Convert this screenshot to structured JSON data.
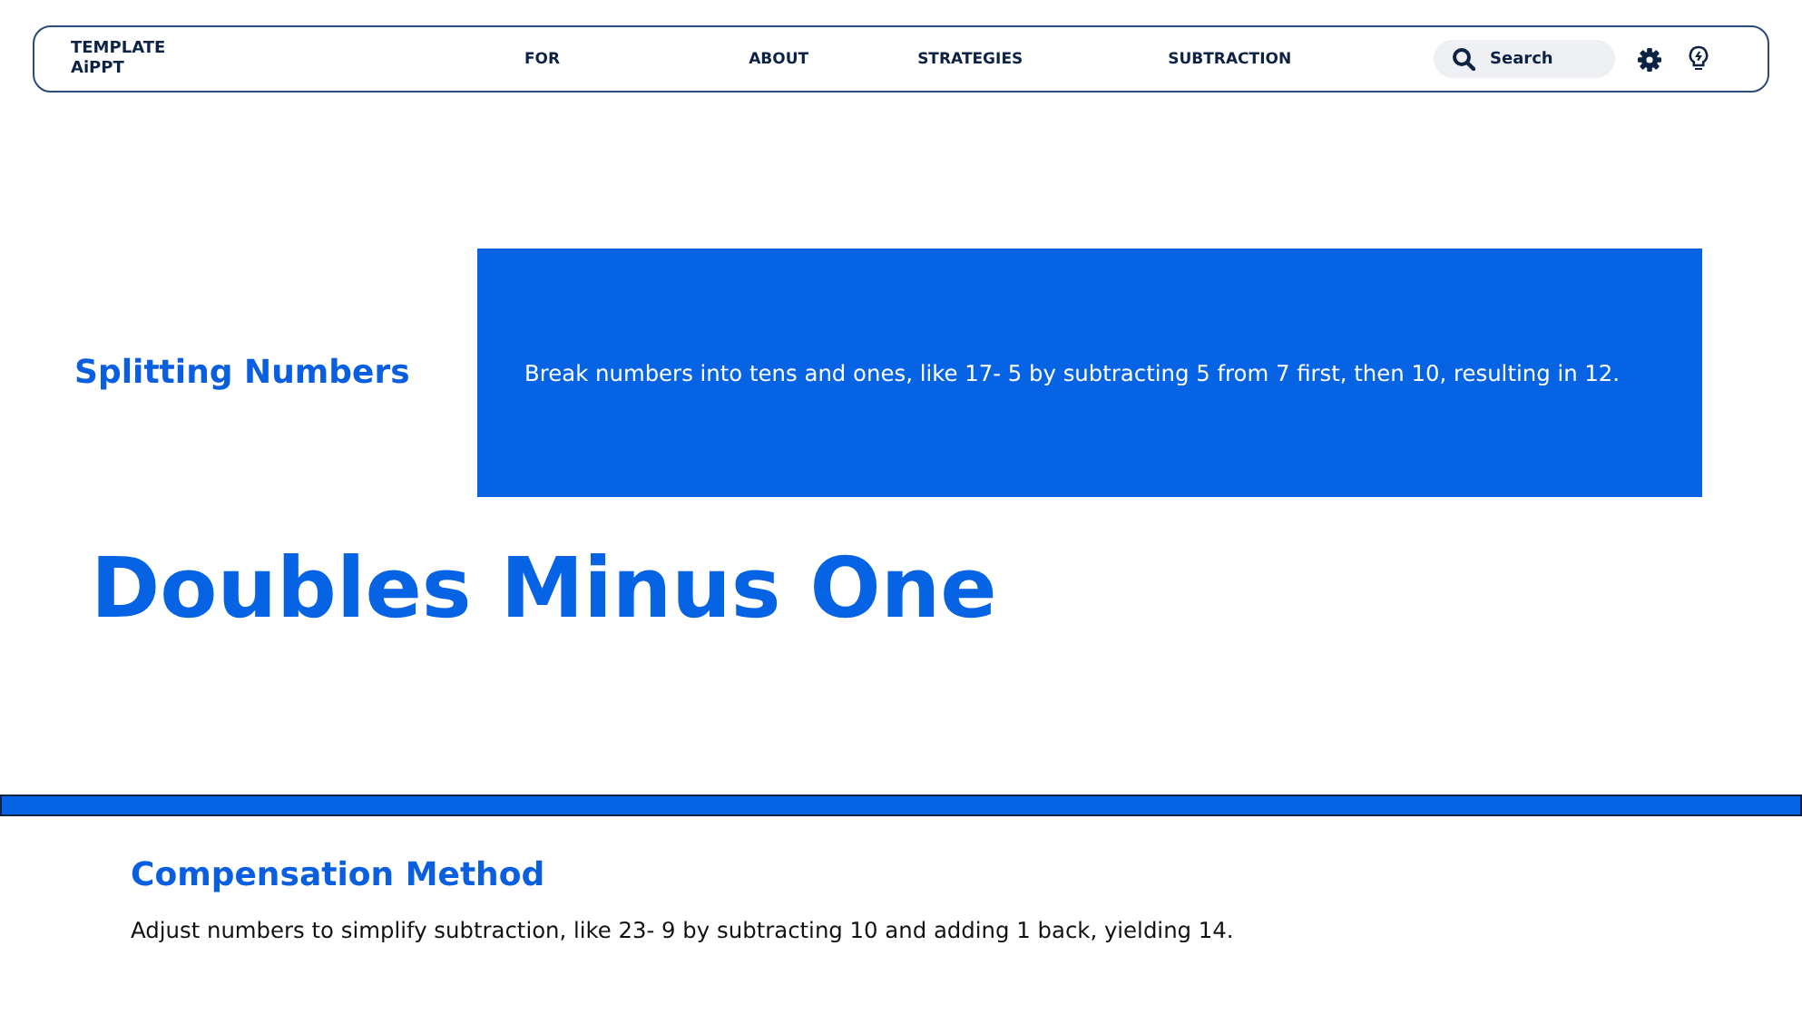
{
  "logo": {
    "lines": [
      "TEMPLATE",
      "AiPPT"
    ]
  },
  "nav": {
    "items": [
      "FOR",
      "ABOUT",
      "STRATEGIES",
      "SUBTRACTION"
    ]
  },
  "search": {
    "placeholder": "Search"
  },
  "feature": {
    "label": "Splitting Numbers",
    "text": "Break numbers into tens and ones, like 17- 5 by subtracting 5 from 7 first, then 10, resulting in 12."
  },
  "title": "Doubles Minus One",
  "section": {
    "heading": "Compensation Method",
    "text": "Adjust numbers to simplify subtraction, like 23- 9 by subtracting 10 and adding 1 back, yielding 14."
  }
}
